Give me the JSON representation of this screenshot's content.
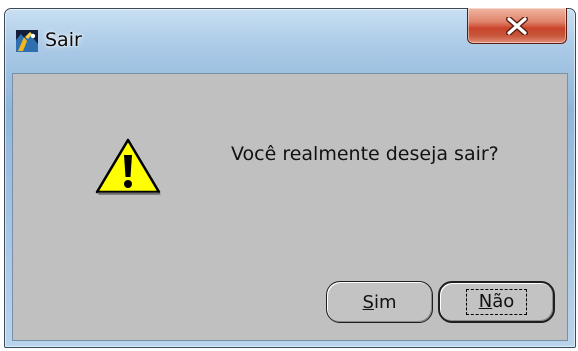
{
  "window": {
    "title": "Sair",
    "icon": "app-logo-icon",
    "close_icon": "close-icon"
  },
  "dialog": {
    "icon": "warning-icon",
    "message": "Você realmente deseja sair?"
  },
  "buttons": {
    "sim": {
      "mnemonic": "S",
      "rest": "im"
    },
    "nao": {
      "mnemonic": "N",
      "rest": "ão"
    }
  },
  "colors": {
    "close_button": "#c8442b",
    "client_background": "#c0c0c0",
    "warning_fill": "#ffff00"
  }
}
